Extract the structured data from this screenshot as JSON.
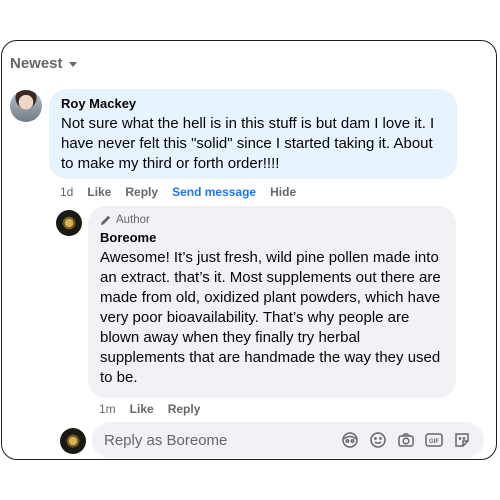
{
  "sort": {
    "label": "Newest"
  },
  "comment": {
    "author": "Roy Mackey",
    "text": "Not sure what the hell is in this stuff is but dam I love it. I have never felt this \"solid\" since I started taking it. About to make my third or forth order!!!!",
    "time": "1d",
    "like_label": "Like",
    "reply_label": "Reply",
    "send_message_label": "Send message",
    "hide_label": "Hide"
  },
  "reply": {
    "badge": "Author",
    "author": "Boreome",
    "text": "Awesome! It’s just fresh, wild pine pollen made into an extract. that’s it. Most supplements out there are made from old, oxidized plant powders, which have very poor bioavailability. That’s why people are blown away when they finally try herbal supplements that are handmade the way they used to be.",
    "time": "1m",
    "like_label": "Like",
    "reply_label": "Reply"
  },
  "reply_box": {
    "placeholder": "Reply as Boreome",
    "icons": [
      "avatar-sticker-icon",
      "emoji-icon",
      "camera-icon",
      "gif-icon",
      "sticker-icon"
    ]
  },
  "colors": {
    "accent": "#1877f2",
    "bubble_highlight": "#e7f3ff",
    "bubble": "#f0f2f5",
    "muted": "#65676b"
  }
}
